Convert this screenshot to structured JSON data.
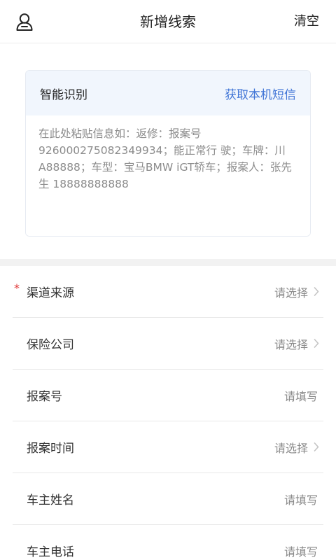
{
  "header": {
    "title": "新增线索",
    "clear_label": "清空"
  },
  "recognition": {
    "title": "智能识别",
    "sms_label": "获取本机短信",
    "placeholder": "在此处粘贴信息如：返修：报案号926000275082349934；能正常行 驶；车牌：川A88888；车型：宝马BMW iGT轿车；报案人：张先生 18888888888"
  },
  "form": {
    "rows": [
      {
        "label": "渠道来源",
        "value": "请选择",
        "required": true
      },
      {
        "label": "保险公司",
        "value": "请选择"
      },
      {
        "label": "报案号",
        "value": "请填写"
      },
      {
        "label": "报案时间",
        "value": "请选择"
      },
      {
        "label": "车主姓名",
        "value": "请填写"
      },
      {
        "label": "车主电话",
        "value": "请填写"
      }
    ],
    "required_mark": "*"
  },
  "icons": {
    "user": "user-outline-icon",
    "chevron": "chevron-right-icon"
  },
  "colors": {
    "accent": "#3f74d6",
    "required": "#e03a3a",
    "card_header_bg": "#f1f6fd"
  }
}
